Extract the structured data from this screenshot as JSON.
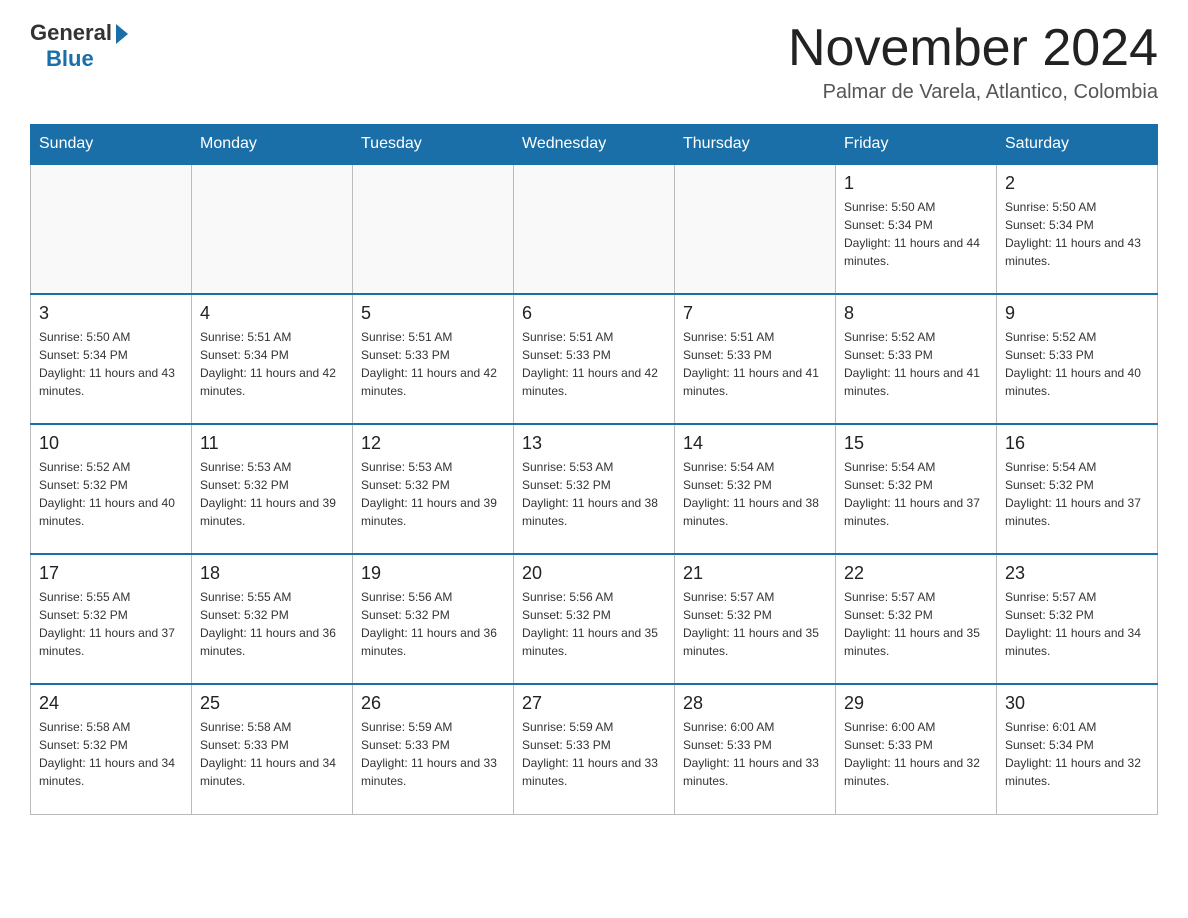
{
  "header": {
    "logo_general": "General",
    "logo_blue": "Blue",
    "month_title": "November 2024",
    "subtitle": "Palmar de Varela, Atlantico, Colombia"
  },
  "days_of_week": [
    "Sunday",
    "Monday",
    "Tuesday",
    "Wednesday",
    "Thursday",
    "Friday",
    "Saturday"
  ],
  "weeks": [
    [
      {
        "day": "",
        "info": ""
      },
      {
        "day": "",
        "info": ""
      },
      {
        "day": "",
        "info": ""
      },
      {
        "day": "",
        "info": ""
      },
      {
        "day": "",
        "info": ""
      },
      {
        "day": "1",
        "info": "Sunrise: 5:50 AM\nSunset: 5:34 PM\nDaylight: 11 hours and 44 minutes."
      },
      {
        "day": "2",
        "info": "Sunrise: 5:50 AM\nSunset: 5:34 PM\nDaylight: 11 hours and 43 minutes."
      }
    ],
    [
      {
        "day": "3",
        "info": "Sunrise: 5:50 AM\nSunset: 5:34 PM\nDaylight: 11 hours and 43 minutes."
      },
      {
        "day": "4",
        "info": "Sunrise: 5:51 AM\nSunset: 5:34 PM\nDaylight: 11 hours and 42 minutes."
      },
      {
        "day": "5",
        "info": "Sunrise: 5:51 AM\nSunset: 5:33 PM\nDaylight: 11 hours and 42 minutes."
      },
      {
        "day": "6",
        "info": "Sunrise: 5:51 AM\nSunset: 5:33 PM\nDaylight: 11 hours and 42 minutes."
      },
      {
        "day": "7",
        "info": "Sunrise: 5:51 AM\nSunset: 5:33 PM\nDaylight: 11 hours and 41 minutes."
      },
      {
        "day": "8",
        "info": "Sunrise: 5:52 AM\nSunset: 5:33 PM\nDaylight: 11 hours and 41 minutes."
      },
      {
        "day": "9",
        "info": "Sunrise: 5:52 AM\nSunset: 5:33 PM\nDaylight: 11 hours and 40 minutes."
      }
    ],
    [
      {
        "day": "10",
        "info": "Sunrise: 5:52 AM\nSunset: 5:32 PM\nDaylight: 11 hours and 40 minutes."
      },
      {
        "day": "11",
        "info": "Sunrise: 5:53 AM\nSunset: 5:32 PM\nDaylight: 11 hours and 39 minutes."
      },
      {
        "day": "12",
        "info": "Sunrise: 5:53 AM\nSunset: 5:32 PM\nDaylight: 11 hours and 39 minutes."
      },
      {
        "day": "13",
        "info": "Sunrise: 5:53 AM\nSunset: 5:32 PM\nDaylight: 11 hours and 38 minutes."
      },
      {
        "day": "14",
        "info": "Sunrise: 5:54 AM\nSunset: 5:32 PM\nDaylight: 11 hours and 38 minutes."
      },
      {
        "day": "15",
        "info": "Sunrise: 5:54 AM\nSunset: 5:32 PM\nDaylight: 11 hours and 37 minutes."
      },
      {
        "day": "16",
        "info": "Sunrise: 5:54 AM\nSunset: 5:32 PM\nDaylight: 11 hours and 37 minutes."
      }
    ],
    [
      {
        "day": "17",
        "info": "Sunrise: 5:55 AM\nSunset: 5:32 PM\nDaylight: 11 hours and 37 minutes."
      },
      {
        "day": "18",
        "info": "Sunrise: 5:55 AM\nSunset: 5:32 PM\nDaylight: 11 hours and 36 minutes."
      },
      {
        "day": "19",
        "info": "Sunrise: 5:56 AM\nSunset: 5:32 PM\nDaylight: 11 hours and 36 minutes."
      },
      {
        "day": "20",
        "info": "Sunrise: 5:56 AM\nSunset: 5:32 PM\nDaylight: 11 hours and 35 minutes."
      },
      {
        "day": "21",
        "info": "Sunrise: 5:57 AM\nSunset: 5:32 PM\nDaylight: 11 hours and 35 minutes."
      },
      {
        "day": "22",
        "info": "Sunrise: 5:57 AM\nSunset: 5:32 PM\nDaylight: 11 hours and 35 minutes."
      },
      {
        "day": "23",
        "info": "Sunrise: 5:57 AM\nSunset: 5:32 PM\nDaylight: 11 hours and 34 minutes."
      }
    ],
    [
      {
        "day": "24",
        "info": "Sunrise: 5:58 AM\nSunset: 5:32 PM\nDaylight: 11 hours and 34 minutes."
      },
      {
        "day": "25",
        "info": "Sunrise: 5:58 AM\nSunset: 5:33 PM\nDaylight: 11 hours and 34 minutes."
      },
      {
        "day": "26",
        "info": "Sunrise: 5:59 AM\nSunset: 5:33 PM\nDaylight: 11 hours and 33 minutes."
      },
      {
        "day": "27",
        "info": "Sunrise: 5:59 AM\nSunset: 5:33 PM\nDaylight: 11 hours and 33 minutes."
      },
      {
        "day": "28",
        "info": "Sunrise: 6:00 AM\nSunset: 5:33 PM\nDaylight: 11 hours and 33 minutes."
      },
      {
        "day": "29",
        "info": "Sunrise: 6:00 AM\nSunset: 5:33 PM\nDaylight: 11 hours and 32 minutes."
      },
      {
        "day": "30",
        "info": "Sunrise: 6:01 AM\nSunset: 5:34 PM\nDaylight: 11 hours and 32 minutes."
      }
    ]
  ]
}
